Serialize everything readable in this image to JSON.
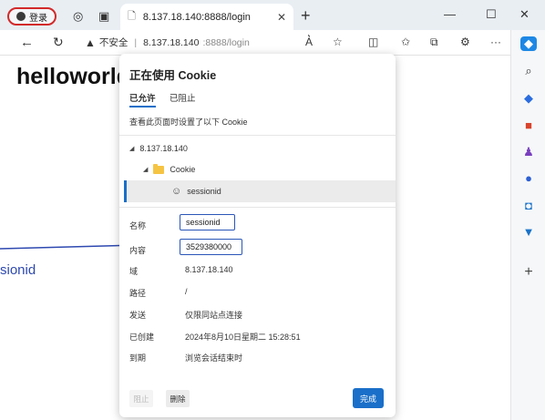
{
  "browser": {
    "profile_label": "登录",
    "tab_title": "8.137.18.140:8888/login",
    "address": {
      "insecure_label": "不安全",
      "host": "8.137.18.140",
      "path": ":8888/login"
    },
    "colors": {
      "accent": "#1a6fc9",
      "profile_border": "#d22a2a",
      "annotation": "#2e49b0"
    }
  },
  "page": {
    "heading": "helloworld",
    "annotation_text": "sionid"
  },
  "cookie_popup": {
    "title": "正在使用 Cookie",
    "tabs": [
      "已允许",
      "已阻止"
    ],
    "active_tab": "已允许",
    "description": "查看此页面时设置了以下 Cookie",
    "tree": {
      "site": "8.137.18.140",
      "folder": "Cookie",
      "cookie": "sessionid"
    },
    "details": [
      {
        "label": "名称",
        "value": "sessionid"
      },
      {
        "label": "内容",
        "value": "3529380000"
      },
      {
        "label": "域",
        "value": "8.137.18.140"
      },
      {
        "label": "路径",
        "value": "/"
      },
      {
        "label": "发送",
        "value": "仅限同站点连接"
      },
      {
        "label": "已创建",
        "value": "2024年8月10日星期二 15:28:51"
      },
      {
        "label": "到期",
        "value": "浏览会话结束时"
      }
    ],
    "buttons": {
      "block": "阻止",
      "remove": "删除",
      "done": "完成"
    }
  }
}
